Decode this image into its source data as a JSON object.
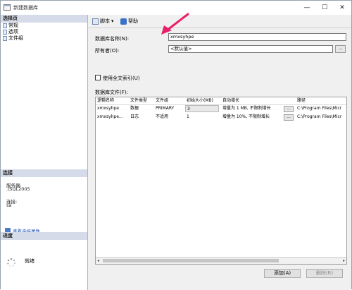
{
  "window": {
    "title": "新建数据库",
    "minimize_glyph": "—",
    "maximize_glyph": "☐",
    "close_glyph": "✕"
  },
  "left_panel": {
    "select_page_header": "选择页",
    "pages": [
      {
        "label": "常规",
        "icon": "page-icon"
      },
      {
        "label": "选项",
        "icon": "page-icon"
      },
      {
        "label": "文件组",
        "icon": "page-icon"
      }
    ],
    "connection_header": "连接",
    "server_label": "服务器:",
    "server_value": ".\\SQL2005",
    "connection_label": "连接:",
    "connection_value": "sa",
    "view_connection_link": "查看连接属性",
    "progress_header": "进度",
    "progress_status": "就绪"
  },
  "toolbar": {
    "script_label": "脚本",
    "help_label": "帮助",
    "script_dropdown_glyph": "▾"
  },
  "form": {
    "db_name_label": "数据库名称(N):",
    "db_name_value": "xmxsyhpe",
    "owner_label": "所有者(O):",
    "owner_value": "<默认值>",
    "fulltext_label": "使用全文索引(U)",
    "db_files_label": "数据库文件(F):",
    "browse_glyph": "..."
  },
  "files_table": {
    "columns": [
      "逻辑名称",
      "文件类型",
      "文件组",
      "初始大小(MB)",
      "自动增长",
      "路径"
    ],
    "rows": [
      {
        "logical_name": "xmxsyhpe",
        "file_type": "数据",
        "filegroup": "PRIMARY",
        "initial_size": "3",
        "autogrowth": "增量为 1 MB, 不限制增长",
        "path": "C:\\Program Files\\Micr"
      },
      {
        "logical_name": "xmxsyhpe...",
        "file_type": "日志",
        "filegroup": "不适用",
        "initial_size": "1",
        "autogrowth": "增量为 10%, 不限制增长",
        "path": "C:\\Program Files\\Micr"
      }
    ]
  },
  "buttons": {
    "add_label": "添加(A)",
    "remove_label": "删除(R)"
  },
  "colors": {
    "annotation_arrow": "#e8206a",
    "section_header_bg": "#d6dbe9",
    "link": "#1a4fb5"
  }
}
